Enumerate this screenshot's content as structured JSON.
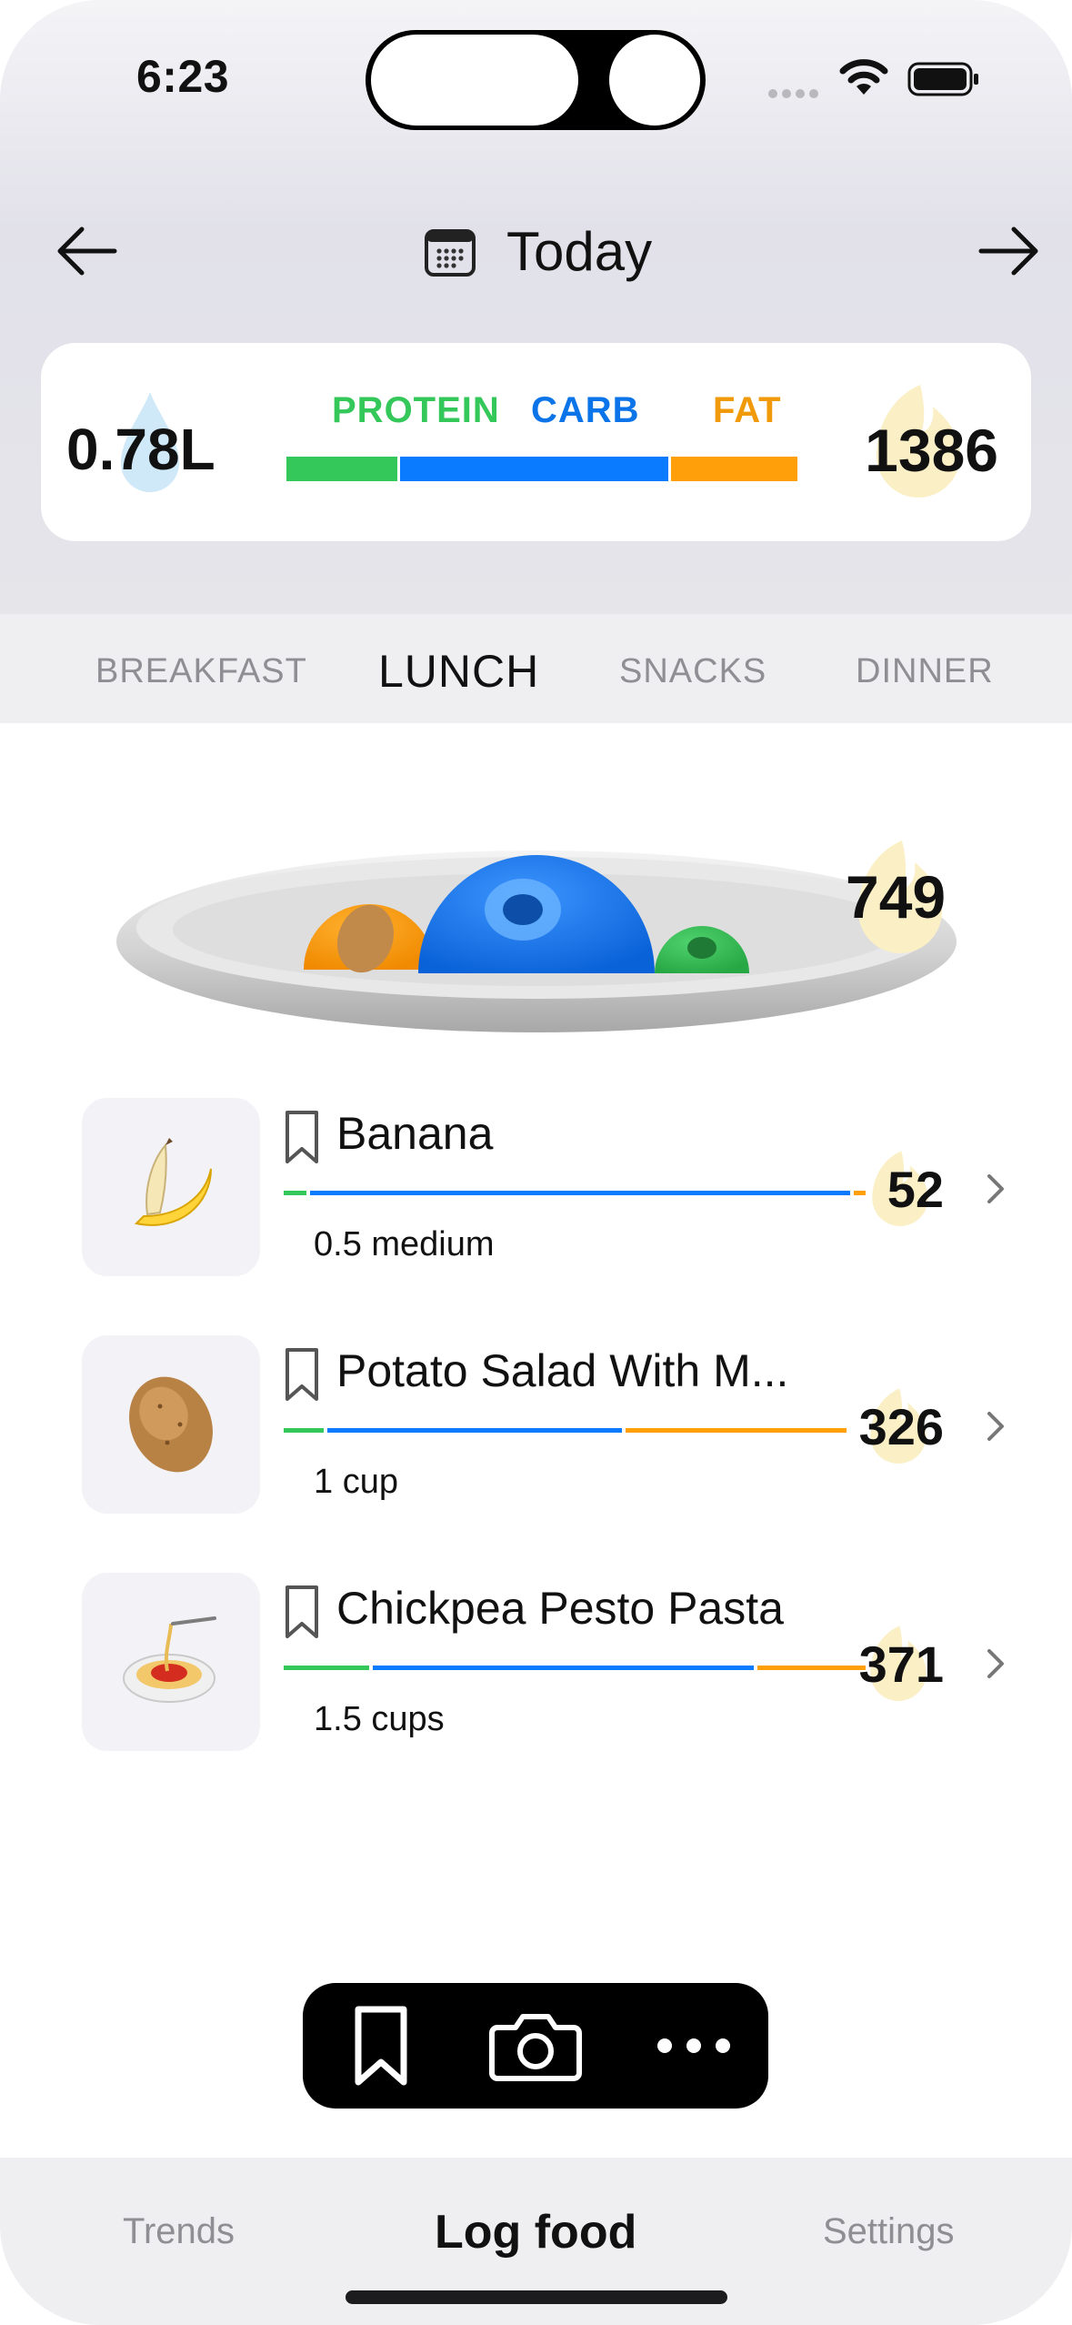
{
  "status_bar": {
    "time": "6:23"
  },
  "header": {
    "date_label": "Today"
  },
  "summary": {
    "water": "0.78L",
    "macro_labels": {
      "protein": "PROTEIN",
      "carb": "CARB",
      "fat": "FAT"
    },
    "macro_split": {
      "protein": 0.22,
      "carb": 0.53,
      "fat": 0.25
    },
    "calories": "1386"
  },
  "meal_tabs": {
    "breakfast": "BREAKFAST",
    "lunch": "LUNCH",
    "snacks": "SNACKS",
    "dinner": "DINNER",
    "active": "LUNCH"
  },
  "plate": {
    "calories": "749"
  },
  "foods": [
    {
      "name": "Banana",
      "serving": "0.5 medium",
      "calories": "52",
      "icon": "banana-icon",
      "macro_split": {
        "protein": 0.04,
        "carb": 0.94,
        "fat": 0.02
      }
    },
    {
      "name": "Potato Salad With M...",
      "serving": "1 cup",
      "calories": "326",
      "icon": "potato-icon",
      "macro_split": {
        "protein": 0.07,
        "carb": 0.52,
        "fat": 0.39
      }
    },
    {
      "name": "Chickpea Pesto Pasta",
      "serving": "1.5 cups",
      "calories": "371",
      "icon": "spaghetti-icon",
      "macro_split": {
        "protein": 0.15,
        "carb": 0.67,
        "fat": 0.19
      }
    }
  ],
  "action_bar": {
    "buttons": [
      "bookmark-icon",
      "camera-icon",
      "more-icon"
    ]
  },
  "tab_bar": {
    "trends": "Trends",
    "log_food": "Log food",
    "settings": "Settings",
    "active": "Log food"
  },
  "colors": {
    "protein": "#34c759",
    "carb": "#0a7aff",
    "fat": "#ff9f0a"
  }
}
